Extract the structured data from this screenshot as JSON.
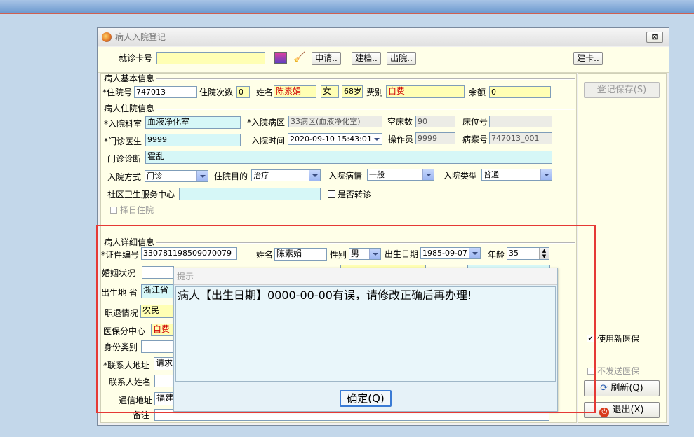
{
  "window": {
    "title": "病人入院登记",
    "close_label": "⊠"
  },
  "card": {
    "label": "就诊卡号",
    "value": "",
    "apply": "申请..",
    "archive": "建档..",
    "discharge": "出院..",
    "create_card": "建卡.."
  },
  "basic": {
    "section": "病人基本信息",
    "admission_no_label": "*住院号",
    "admission_no": "747013",
    "times_label": "住院次数",
    "times": "0",
    "name_label": "姓名",
    "name": "陈素娟",
    "gender": "女",
    "age": "68岁",
    "fee_label": "费别",
    "fee": "自费",
    "balance_label": "余额",
    "balance": "0"
  },
  "stay": {
    "section": "病人住院信息",
    "dept_label": "*入院科室",
    "dept": "血液净化室",
    "ward_label": "*入院病区",
    "ward": "33病区(血液净化室)",
    "empty_beds_label": "空床数",
    "empty_beds": "90",
    "bed_label": "床位号",
    "bed": "",
    "doctor_label": "*门诊医生",
    "doctor": "9999",
    "time_label": "入院时间",
    "time": "2020-09-10 15:43:01",
    "operator_label": "操作员",
    "operator": "9999",
    "record_label": "病案号",
    "record": "747013_001",
    "diagnosis_label": "门诊诊断",
    "diagnosis": "霍乱",
    "mode_label": "入院方式",
    "mode": "门诊",
    "purpose_label": "住院目的",
    "purpose": "治疗",
    "condition_label": "入院病情",
    "condition": "一般",
    "type_label": "入院类型",
    "type": "普通",
    "community_label": "社区卫生服务中心",
    "community": "",
    "transfer_label": "是否转诊",
    "select_day_label": "择日住院"
  },
  "detail": {
    "section": "病人详细信息",
    "id_label": "*证件编号",
    "id_no": "330781198509070079",
    "name_label": "姓名",
    "name": "陈素娟",
    "gender_label": "性别",
    "gender": "男",
    "birth_label": "出生日期",
    "birth": "1985-09-07",
    "age_label": "年龄",
    "age": "35",
    "marital_label": "婚姻状况",
    "birthplace_label": "出生地 省",
    "province": "浙江省",
    "occupation_label": "职退情况",
    "occupation": "农民",
    "insurance_center_label": "医保分中心",
    "insurance_center": "自费",
    "identity_label": "身份类别",
    "contact_addr_label": "*联系人地址",
    "contact_addr": "请求",
    "contact_name_label": "联系人姓名",
    "mail_label": "通信地址",
    "mail": "福建",
    "remark_label": "备注"
  },
  "side": {
    "save": "登记保存(S)",
    "new_insurance": "使用新医保",
    "no_send": "不发送医保",
    "refresh": "刷新(Q)",
    "exit": "退出(X)"
  },
  "dialog": {
    "title": "提示",
    "message": "病人【出生日期】0000-00-00有误，请修改正确后再办理!",
    "ok": "确定(Q)"
  },
  "colors": {
    "highlight": "#e53935",
    "accent_red": "#d00000"
  }
}
